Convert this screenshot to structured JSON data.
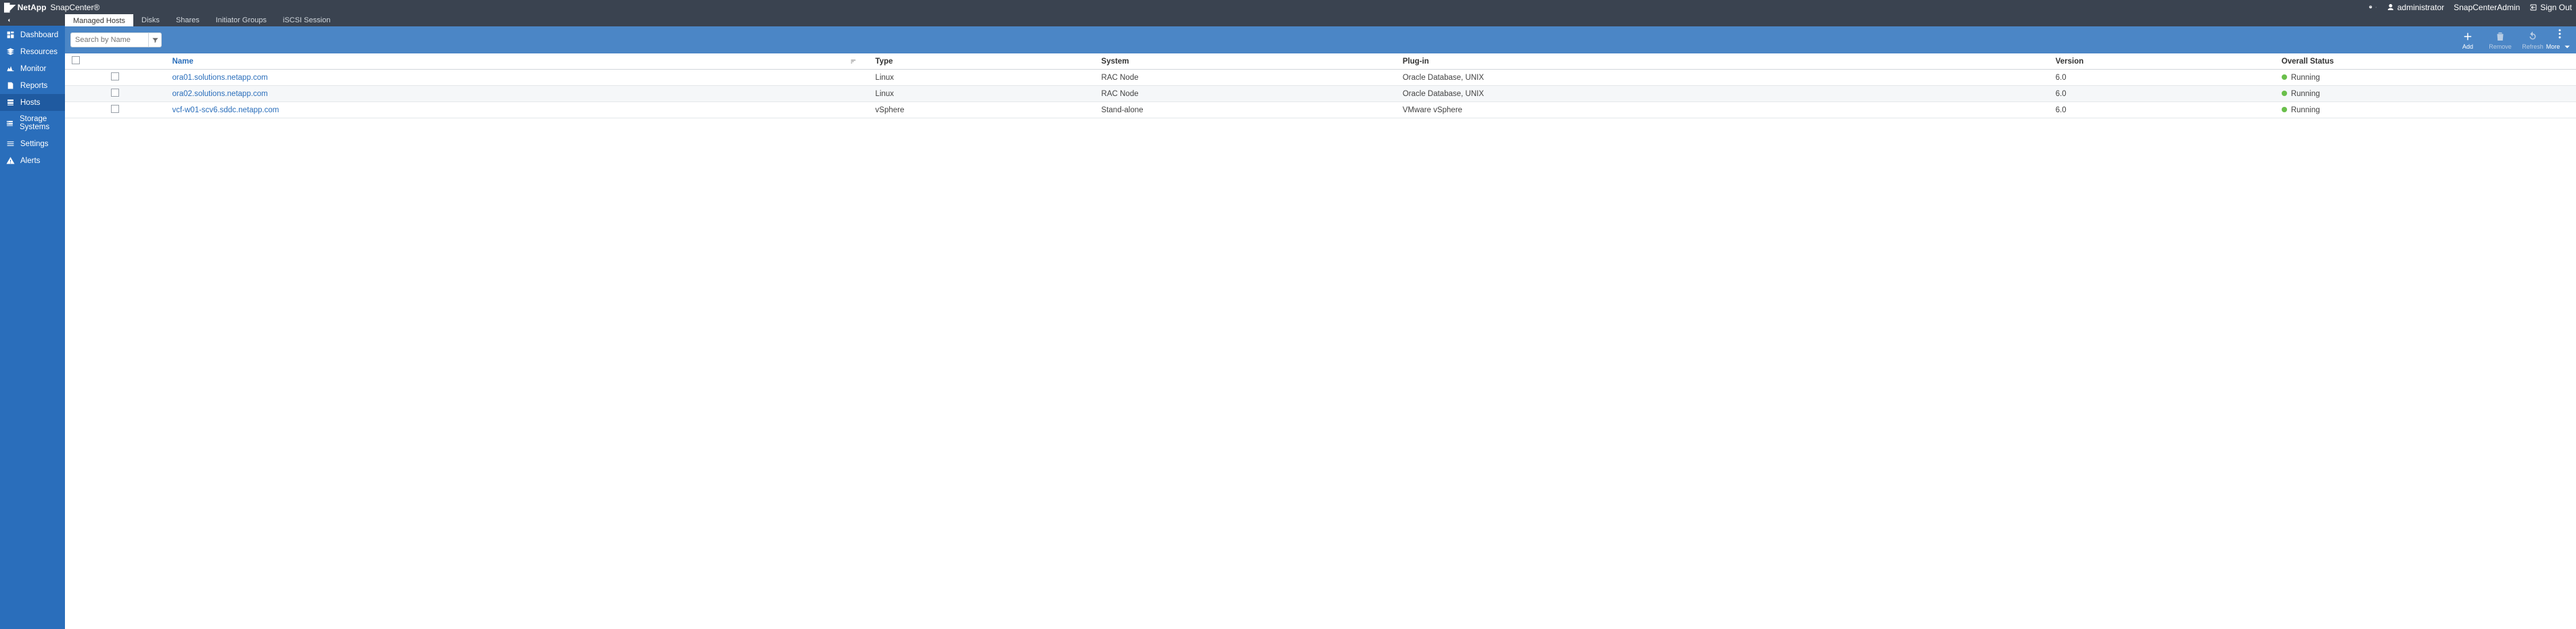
{
  "brand": {
    "company": "NetApp",
    "product": "SnapCenter®"
  },
  "top": {
    "user_label": "administrator",
    "role_label": "SnapCenterAdmin",
    "signout_label": "Sign Out"
  },
  "sidebar": {
    "items": [
      {
        "key": "dashboard",
        "label": "Dashboard"
      },
      {
        "key": "resources",
        "label": "Resources"
      },
      {
        "key": "monitor",
        "label": "Monitor"
      },
      {
        "key": "reports",
        "label": "Reports"
      },
      {
        "key": "hosts",
        "label": "Hosts"
      },
      {
        "key": "storage",
        "label": "Storage Systems"
      },
      {
        "key": "settings",
        "label": "Settings"
      },
      {
        "key": "alerts",
        "label": "Alerts"
      }
    ],
    "active_index": 4
  },
  "tabs": {
    "items": [
      "Managed Hosts",
      "Disks",
      "Shares",
      "Initiator Groups",
      "iSCSI Session"
    ],
    "active_index": 0
  },
  "search": {
    "placeholder": "Search by Name"
  },
  "actions": {
    "add": "Add",
    "remove": "Remove",
    "refresh": "Refresh",
    "more": "More"
  },
  "columns": {
    "name": "Name",
    "type": "Type",
    "system": "System",
    "plugin": "Plug-in",
    "version": "Version",
    "status": "Overall Status"
  },
  "rows": [
    {
      "name": "ora01.solutions.netapp.com",
      "type": "Linux",
      "system": "RAC Node",
      "plugin": "Oracle Database, UNIX",
      "version": "6.0",
      "status": "Running"
    },
    {
      "name": "ora02.solutions.netapp.com",
      "type": "Linux",
      "system": "RAC Node",
      "plugin": "Oracle Database, UNIX",
      "version": "6.0",
      "status": "Running"
    },
    {
      "name": "vcf-w01-scv6.sddc.netapp.com",
      "type": "vSphere",
      "system": "Stand-alone",
      "plugin": "VMware vSphere",
      "version": "6.0",
      "status": "Running"
    }
  ]
}
